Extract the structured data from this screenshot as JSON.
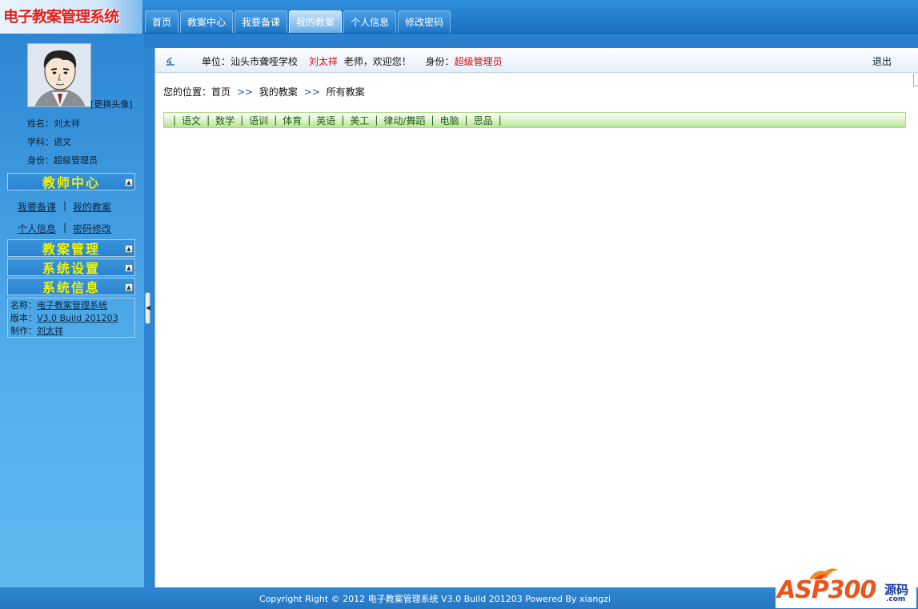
{
  "header": {
    "logo": "电子教案管理系统",
    "tabs": [
      {
        "label": "首页"
      },
      {
        "label": "教案中心"
      },
      {
        "label": "我要备课"
      },
      {
        "label": "我的教案"
      },
      {
        "label": "个人信息"
      },
      {
        "label": "修改密码"
      }
    ],
    "active_tab": "我的教案"
  },
  "sidebar": {
    "change_avatar": "[更换头像]",
    "name_line": "姓名：刘太祥",
    "subject_line": "学科：语文",
    "role_line": "身份：超级管理员",
    "sections": {
      "teacher_center": "教师中心",
      "plan_manage": "教案管理",
      "system_settings": "系统设置",
      "system_info": "系统信息"
    },
    "links": {
      "prepare": "我要备课",
      "my_plans": "我的教案",
      "personal_info": "个人信息",
      "change_pwd": "密码修改",
      "sep": "|"
    },
    "sysinfo": {
      "name_label": "名称：",
      "name_value": "电子教案管理系统",
      "version_label": "版本：",
      "version_value": "V3.0 Build 201203",
      "author_label": "制作：",
      "author_value": "刘太祥"
    }
  },
  "infobar": {
    "unit_label": "单位：",
    "unit_value": "汕头市聋哑学校",
    "teacher_name": "刘太祥",
    "welcome": "老师，欢迎您！",
    "role_label": "身份：",
    "role_value": "超级管理员",
    "logout": "退出"
  },
  "breadcrumb": {
    "prefix": "您的位置：",
    "home": "首页",
    "sep": ">>",
    "my_plans": "我的教案",
    "all_plans": "所有教案"
  },
  "categories": [
    "语文",
    "数学",
    "语训",
    "体育",
    "英语",
    "美工",
    "律动/舞蹈",
    "电脑",
    "思品"
  ],
  "footer": {
    "text": "Copyright Right © 2012  电子教案管理系统 V3.0 Build 201203  Powered By xiangzi"
  },
  "watermark": {
    "brand": "ASP300",
    "suffix": "源码",
    "domain": ".com"
  },
  "colors": {
    "header_blue": "#1b6fbe",
    "sidebar_blue": "#2c86d4",
    "section_title_yellow": "#f2f200",
    "highlight_red": "#d01010",
    "category_green": "#1f5f12"
  }
}
